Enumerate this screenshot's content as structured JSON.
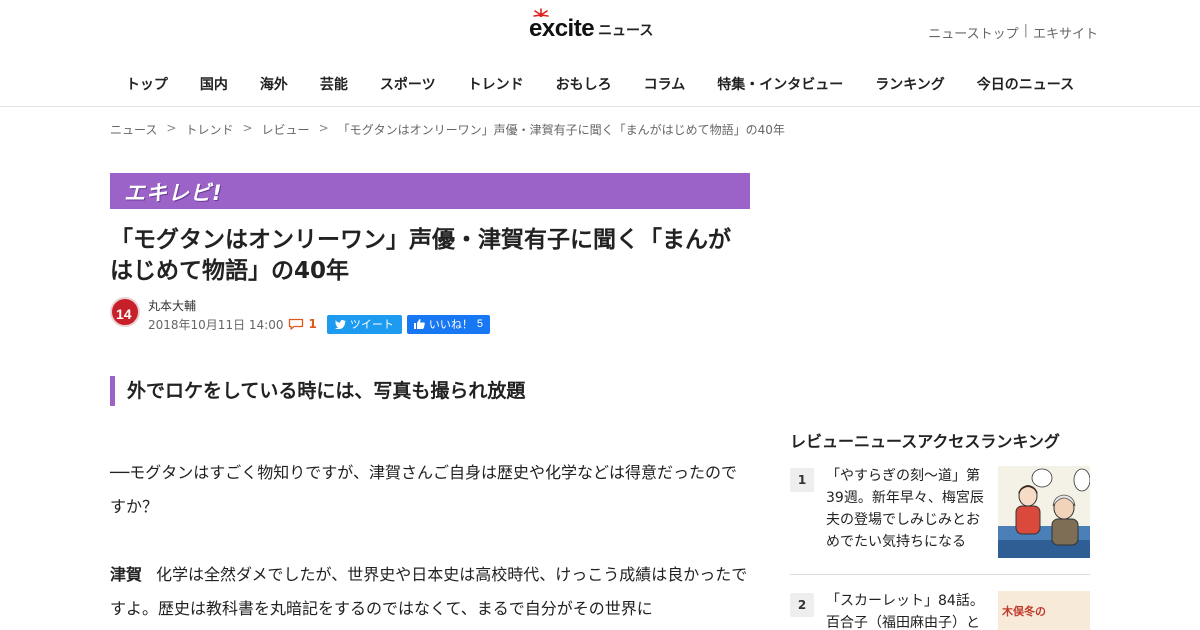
{
  "header": {
    "logo_text": "excite",
    "logo_suffix": "ニュース",
    "top_links": [
      "ニューストップ",
      "エキサイト"
    ],
    "top_links_sep": "|"
  },
  "nav": [
    "トップ",
    "国内",
    "海外",
    "芸能",
    "スポーツ",
    "トレンド",
    "おもしろ",
    "コラム",
    "特集・インタビュー",
    "ランキング",
    "今日のニュース"
  ],
  "breadcrumb": {
    "items": [
      "ニュース",
      "トレンド",
      "レビュー",
      "「モグタンはオンリーワン」声優・津賀有子に聞く「まんがはじめて物語」の40年"
    ],
    "separator": ">"
  },
  "banner": {
    "label": "エキレビ!",
    "color": "#9b63c8"
  },
  "article": {
    "title": "「モグタンはオンリーワン」声優・津賀有子に聞く「まんがはじめて物語」の40年",
    "avatar_text": "14",
    "author": "丸本大輔",
    "date": "2018年10月11日 14:00",
    "comment_count": "1",
    "tweet_label": "ツイート",
    "like_label": "いいね！",
    "like_count": "5",
    "section_heading": "外でロケをしている時には、写真も撮られ放題",
    "question": "──モグタンはすごく物知りですが、津賀さんご自身は歴史や化学などは得意だったのですか？",
    "answer_speaker": "津賀",
    "answer_text": "化学は全然ダメでしたが、世界史や日本史は高校時代、けっこう成績は良かったですよ。歴史は教科書を丸暗記をするのではなくて、まるで自分がその世界に"
  },
  "sidebar": {
    "title": "レビューニュースアクセスランキング",
    "items": [
      {
        "rank": "1",
        "text": "「やすらぎの刻～道」第39週。新年早々、梅宮辰夫の登場でしみじみとおめでたい気持ちになる"
      },
      {
        "rank": "2",
        "text": "「スカーレット」84話。百合子（福田麻由子）と"
      }
    ],
    "thumb2_text": "木俣冬の"
  },
  "colors": {
    "accent": "#9b63c8",
    "tweet": "#1d9bf0",
    "like": "#1877f2",
    "comment": "#e05a20"
  }
}
